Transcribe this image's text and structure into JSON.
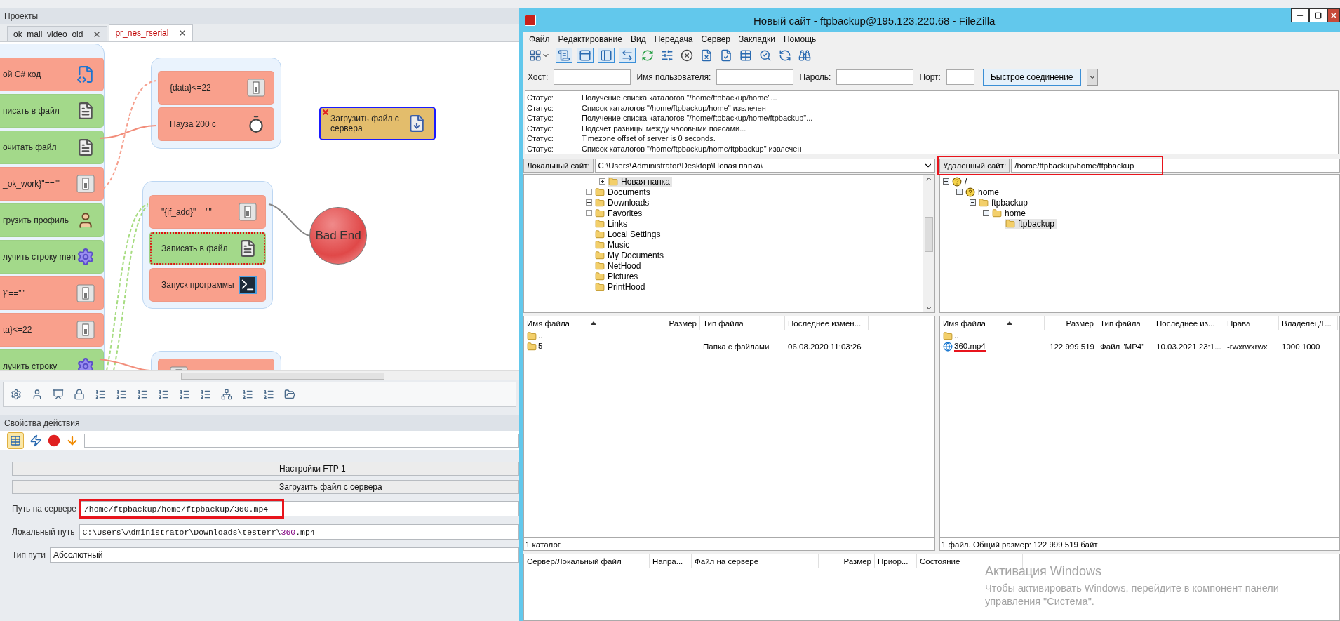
{
  "projects": {
    "title": "Проекты",
    "tabs": [
      {
        "label": "ok_mail_video_old",
        "selected": false
      },
      {
        "label": "pr_nes_rserial",
        "selected": true
      }
    ]
  },
  "canvas": {
    "groups": [
      {
        "nodes": [
          {
            "label": "ой C# код",
            "kind": "csharp",
            "color": "#f9a08c",
            "selected": false,
            "flagged": false,
            "error": false
          },
          {
            "label": "писать в файл",
            "kind": "file",
            "color": "#a3d98a",
            "selected": false,
            "flagged": false,
            "error": false
          },
          {
            "label": "очитать файл",
            "kind": "file",
            "color": "#a3d98a",
            "selected": false,
            "flagged": false,
            "error": false
          },
          {
            "label": "_ok_work}\"==\"\"",
            "kind": "switch",
            "color": "#f9a08c",
            "selected": false,
            "flagged": false,
            "error": false
          },
          {
            "label": "грузить профиль",
            "kind": "profile",
            "color": "#a3d98a",
            "selected": false,
            "flagged": false,
            "error": false
          },
          {
            "label": "лучить строку men",
            "kind": "gear",
            "color": "#a3d98a",
            "selected": false,
            "flagged": false,
            "error": false
          },
          {
            "label": "}\"==\"\"",
            "kind": "switch",
            "color": "#f9a08c",
            "selected": false,
            "flagged": false,
            "error": false
          },
          {
            "label": "ta}<=22",
            "kind": "switch",
            "color": "#f9a08c",
            "selected": false,
            "flagged": false,
            "error": false
          },
          {
            "label": "лучить строку",
            "kind": "gear",
            "color": "#a3d98a",
            "selected": false,
            "flagged": false,
            "error": false
          }
        ]
      },
      {
        "nodes": [
          {
            "label": "{data}<=22",
            "kind": "switch",
            "color": "#f9a08c",
            "selected": false,
            "flagged": false,
            "error": false
          },
          {
            "label": "Пауза 200 с",
            "kind": "timer",
            "color": "#f9a08c",
            "selected": false,
            "flagged": false,
            "error": false
          }
        ]
      },
      {
        "nodes": [
          {
            "label": "\"{if_add}\"==\"\"",
            "kind": "switch",
            "color": "#f9a08c",
            "selected": false,
            "flagged": false,
            "error": false
          },
          {
            "label": "Записать в файл",
            "kind": "file",
            "color": "#a3d98a",
            "selected": false,
            "flagged": true,
            "error": false
          },
          {
            "label": "Запуск программы",
            "kind": "console",
            "color": "#f9a08c",
            "selected": false,
            "flagged": false,
            "error": false
          }
        ]
      },
      {
        "nodes": [
          {
            "kind": "switch",
            "color": "#f9a08c",
            "selected": false,
            "flagged": false,
            "error": false
          }
        ]
      }
    ],
    "floating_nodes": [
      {
        "label": "Загрузить файл с сервера",
        "kind": "download",
        "color": "#e3bd6c",
        "selected": true,
        "flagged": false,
        "error": true
      }
    ],
    "end_node": {
      "label": "Bad End"
    }
  },
  "properties": {
    "title": "Свойства действия",
    "buttons": [
      "Настройки FTP 1",
      "Загрузить файл с сервера"
    ],
    "fields": [
      {
        "label": "Путь на сервере",
        "value": [
          {
            "text": "/home/ftpbackup/home/ftpbackup/360.mp4",
            "kind": "plain"
          }
        ],
        "highlighted": true
      },
      {
        "label": "Локальный путь",
        "value": [
          {
            "text": "C:\\Users\\Administrator\\Downloads\\testerr\\",
            "kind": "plain"
          },
          {
            "text": "360",
            "kind": "variable"
          },
          {
            "text": ".mp4",
            "kind": "plain"
          }
        ],
        "highlighted": false
      },
      {
        "label": "Тип пути",
        "value": [
          {
            "text": "Абсолютный",
            "kind": "sans"
          }
        ],
        "highlighted": false
      }
    ]
  },
  "filezilla": {
    "title": "Новый сайт - ftpbackup@195.123.220.68 - FileZilla",
    "menu": [
      "Файл",
      "Редактирование",
      "Вид",
      "Передача",
      "Сервер",
      "Закладки",
      "Помощь"
    ],
    "quickconnect": {
      "fields": [
        {
          "label": "Хост:"
        },
        {
          "label": "Имя пользователя:"
        },
        {
          "label": "Пароль:"
        },
        {
          "label": "Порт:"
        }
      ],
      "button": "Быстрое соединение"
    },
    "log": [
      {
        "label": "Статус:",
        "message": "Получение списка каталогов \"/home/ftpbackup/home\"..."
      },
      {
        "label": "Статус:",
        "message": "Список каталогов \"/home/ftpbackup/home\" извлечен"
      },
      {
        "label": "Статус:",
        "message": "Получение списка каталогов \"/home/ftpbackup/home/ftpbackup\"..."
      },
      {
        "label": "Статус:",
        "message": "Подсчет разницы между часовыми поясами..."
      },
      {
        "label": "Статус:",
        "message": "Timezone offset of server is 0 seconds."
      },
      {
        "label": "Статус:",
        "message": "Список каталогов \"/home/ftpbackup/home/ftpbackup\" извлечен"
      }
    ],
    "panes": [
      {
        "site_label": "Локальный сайт:",
        "site_path": "C:\\Users\\Administrator\\Desktop\\Новая папка\\",
        "tree": [
          {
            "children": [
              {
                "label": "Новая папка",
                "kind": "folder",
                "has_children": true,
                "expanded": false,
                "selected": true
              }
            ]
          },
          {
            "label": "Documents",
            "kind": "folder",
            "has_children": true,
            "expanded": false,
            "selected": false
          },
          {
            "label": "Downloads",
            "kind": "folder",
            "has_children": true,
            "expanded": false,
            "selected": false
          },
          {
            "label": "Favorites",
            "kind": "folder",
            "has_children": true,
            "expanded": false,
            "selected": false
          },
          {
            "label": "Links",
            "kind": "folder",
            "selected": false
          },
          {
            "label": "Local Settings",
            "kind": "folder",
            "selected": false
          },
          {
            "label": "Music",
            "kind": "folder",
            "selected": false
          },
          {
            "label": "My Documents",
            "kind": "folder",
            "selected": false
          },
          {
            "label": "NetHood",
            "kind": "folder",
            "selected": false
          },
          {
            "label": "Pictures",
            "kind": "folder",
            "selected": false
          },
          {
            "label": "PrintHood",
            "kind": "folder",
            "selected": false
          }
        ],
        "columns": [
          "Имя файла",
          "Размер",
          "Тип файла",
          "Последнее измен..."
        ],
        "rows": [
          {
            "kind": "folder",
            "cells": [
              ".."
            ],
            "annotated": false
          },
          {
            "kind": "folder",
            "cells": [
              "5",
              null,
              "Папка с файлами",
              "06.08.2020 11:03:26"
            ],
            "annotated": false
          }
        ],
        "status": "1 каталог"
      },
      {
        "site_label": "Удаленный сайт:",
        "site_path": "/home/ftpbackup/home/ftpbackup",
        "highlighted": true,
        "tree": [
          {
            "label": "/",
            "kind": "unknown",
            "has_children": true,
            "expanded": true,
            "selected": false,
            "children": [
              {
                "label": "home",
                "kind": "unknown",
                "has_children": true,
                "expanded": true,
                "selected": false,
                "children": [
                  {
                    "label": "ftpbackup",
                    "kind": "folder",
                    "has_children": true,
                    "expanded": true,
                    "selected": false,
                    "children": [
                      {
                        "label": "home",
                        "kind": "folder",
                        "has_children": true,
                        "expanded": true,
                        "selected": false,
                        "children": [
                          {
                            "label": "ftpbackup",
                            "kind": "folder",
                            "selected": true
                          }
                        ]
                      }
                    ]
                  }
                ]
              }
            ]
          }
        ],
        "columns": [
          "Имя файла",
          "Размер",
          "Тип файла",
          "Последнее из...",
          "Права",
          "Владелец/Г..."
        ],
        "rows": [
          {
            "kind": "folder",
            "cells": [
              ".."
            ],
            "annotated": false
          },
          {
            "kind": "video",
            "cells": [
              "360.mp4",
              "122 999 519",
              "Файл \"MP4\"",
              "10.03.2021 23:1...",
              "-rwxrwxrwx",
              "1000 1000"
            ],
            "annotated": true
          }
        ],
        "status": "1 файл. Общий размер: 122 999 519 байт"
      }
    ],
    "queue_columns": [
      "Сервер/Локальный файл",
      "Напра...",
      "Файл на сервере",
      "Размер",
      "Приор...",
      "Состояние"
    ]
  },
  "os_notice": {
    "title": "Активация Windows",
    "text": "Чтобы активировать Windows, перейдите в компонент панели управления \"Система\"."
  }
}
